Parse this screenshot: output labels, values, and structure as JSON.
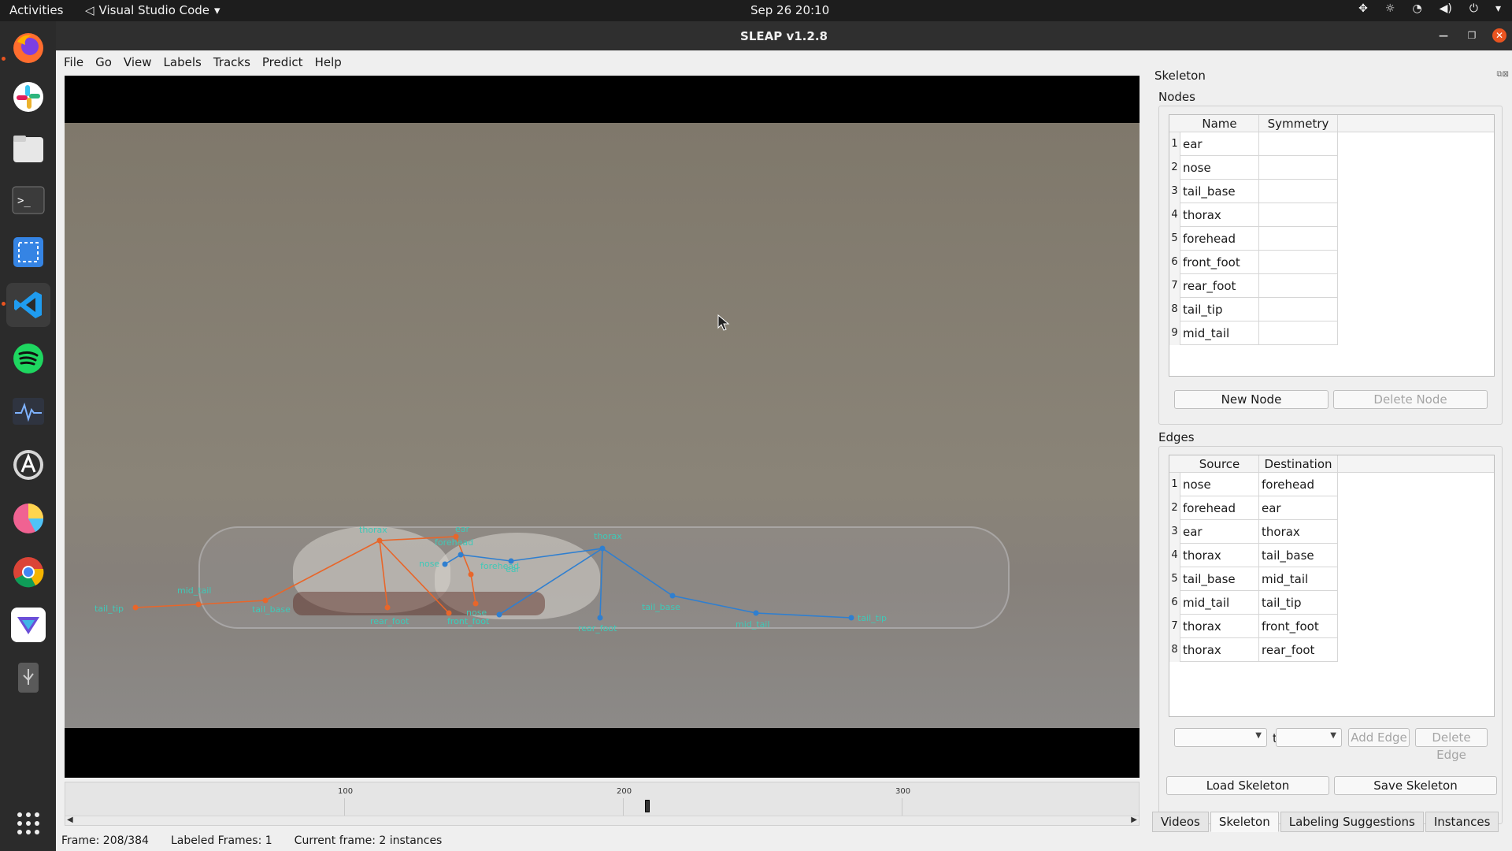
{
  "topbar": {
    "activities": "Activities",
    "app_menu": "Visual Studio Code",
    "clock": "Sep 26  20:10"
  },
  "dock": {
    "items": [
      "firefox-icon",
      "slack-icon",
      "files-icon",
      "terminal-icon",
      "screenshot-icon",
      "vscode-icon",
      "spotify-icon",
      "system-monitor-icon",
      "app-store-icon",
      "pie-app-icon",
      "chrome-icon",
      "sleap-icon",
      "usb-icon",
      "app-grid-icon"
    ]
  },
  "window": {
    "title": "SLEAP v1.2.8"
  },
  "menu": {
    "items": [
      "File",
      "Go",
      "View",
      "Labels",
      "Tracks",
      "Predict",
      "Help"
    ]
  },
  "video": {
    "labels": {
      "orange": [
        "thorax",
        "ear",
        "forehead",
        "nose",
        "mid_tail",
        "tail_tip",
        "tail_base",
        "rear_foot",
        "nose",
        "front_foot"
      ],
      "blue": [
        "thorax",
        "forehead",
        "ear",
        "tail_base",
        "tail_tip",
        "mid_tail",
        "rear_foot",
        "front_foot"
      ]
    }
  },
  "timeline": {
    "ticks": [
      "100",
      "200",
      "300"
    ],
    "current_frame": 208,
    "total_frames": 384
  },
  "status": {
    "frame": "Frame: 208/384",
    "labeled": "Labeled Frames: 1",
    "current": "Current frame: 2 instances"
  },
  "panel": {
    "title": "Skeleton",
    "nodes_title": "Nodes",
    "nodes_headers": [
      "Name",
      "Symmetry"
    ],
    "nodes": [
      {
        "n": "1",
        "name": "ear",
        "sym": ""
      },
      {
        "n": "2",
        "name": "nose",
        "sym": ""
      },
      {
        "n": "3",
        "name": "tail_base",
        "sym": ""
      },
      {
        "n": "4",
        "name": "thorax",
        "sym": ""
      },
      {
        "n": "5",
        "name": "forehead",
        "sym": ""
      },
      {
        "n": "6",
        "name": "front_foot",
        "sym": ""
      },
      {
        "n": "7",
        "name": "rear_foot",
        "sym": ""
      },
      {
        "n": "8",
        "name": "tail_tip",
        "sym": ""
      },
      {
        "n": "9",
        "name": "mid_tail",
        "sym": ""
      }
    ],
    "new_node": "New Node",
    "delete_node": "Delete Node",
    "edges_title": "Edges",
    "edges_headers": [
      "Source",
      "Destination"
    ],
    "edges": [
      {
        "n": "1",
        "src": "nose",
        "dst": "forehead"
      },
      {
        "n": "2",
        "src": "forehead",
        "dst": "ear"
      },
      {
        "n": "3",
        "src": "ear",
        "dst": "thorax"
      },
      {
        "n": "4",
        "src": "thorax",
        "dst": "tail_base"
      },
      {
        "n": "5",
        "src": "tail_base",
        "dst": "mid_tail"
      },
      {
        "n": "6",
        "src": "mid_tail",
        "dst": "tail_tip"
      },
      {
        "n": "7",
        "src": "thorax",
        "dst": "front_foot"
      },
      {
        "n": "8",
        "src": "thorax",
        "dst": "rear_foot"
      }
    ],
    "to_label": "to",
    "add_edge": "Add Edge",
    "delete_edge": "Delete Edge",
    "load_skeleton": "Load Skeleton",
    "save_skeleton": "Save Skeleton"
  },
  "tabs": [
    "Videos",
    "Skeleton",
    "Labeling Suggestions",
    "Instances"
  ]
}
